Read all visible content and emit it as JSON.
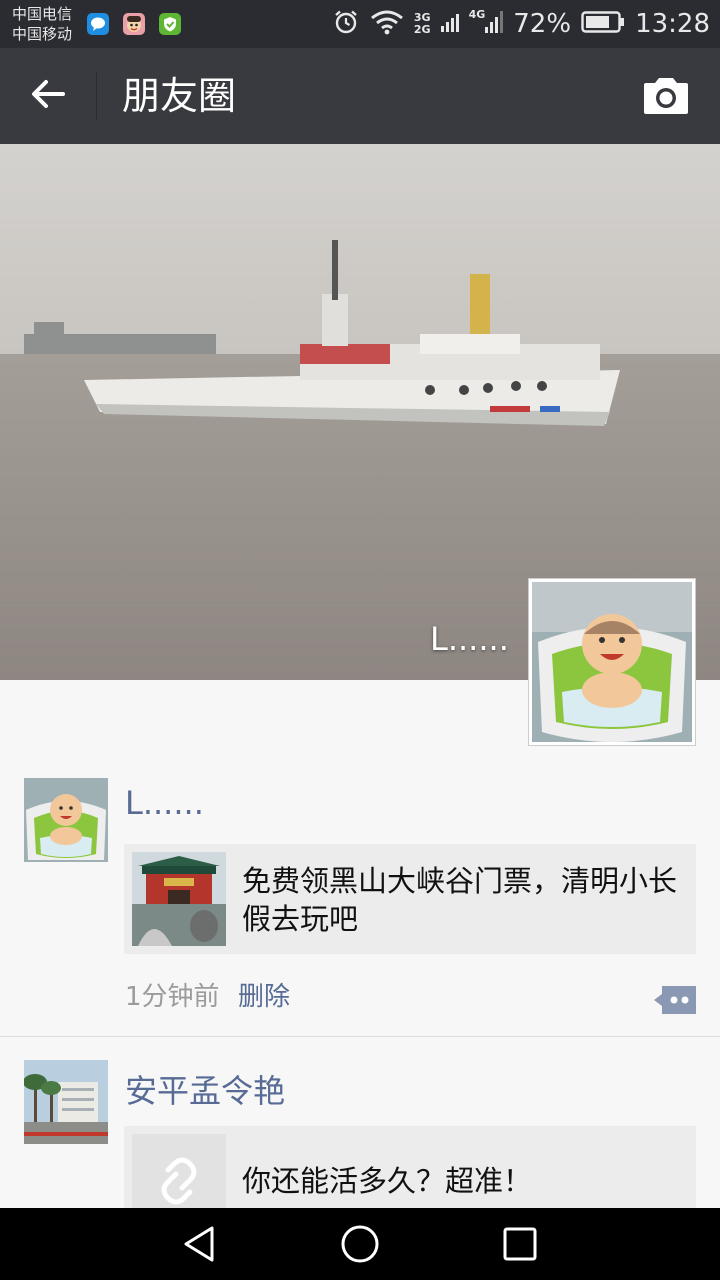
{
  "status_bar": {
    "carrier_1": "中国电信",
    "carrier_2": "中国移动",
    "network_1": "3G",
    "network_2": "2G",
    "network_3": "4G",
    "battery": "72%",
    "time": "13:28",
    "app_icons": [
      "message-icon",
      "avatar-app-icon",
      "shield-app-icon"
    ]
  },
  "nav": {
    "title": "朋友圈",
    "back_icon": "arrow-left-icon",
    "camera_icon": "camera-icon"
  },
  "cover": {
    "owner_name": "L......"
  },
  "feed": [
    {
      "username": "L......",
      "share_text": "免费领黑山大峡谷门票，清明小长假去玩吧",
      "time": "1分钟前",
      "delete_label": "删除"
    },
    {
      "username": "安平孟令艳",
      "share_text": "你还能活多久？超准！"
    }
  ],
  "colors": {
    "status_bg": "#2b2c31",
    "nav_bg": "#393a3f",
    "link": "#576b95",
    "card_bg": "#ececec"
  }
}
